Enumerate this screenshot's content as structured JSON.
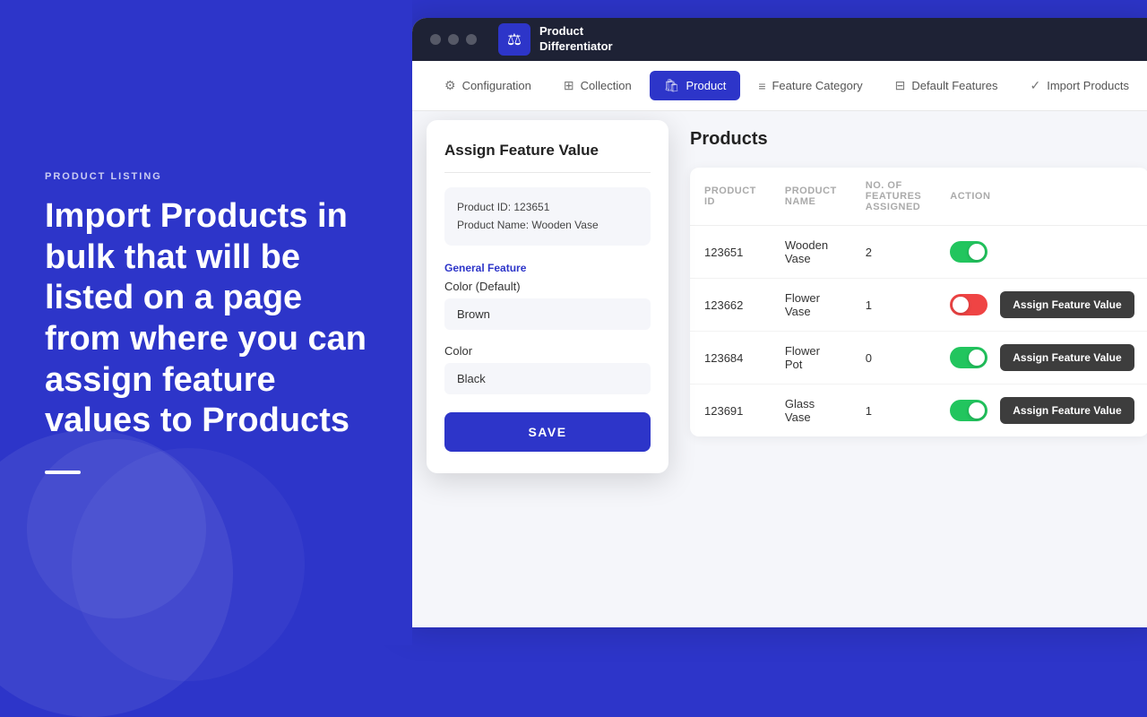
{
  "left": {
    "section_label": "PRODUCT LISTING",
    "heading": "Import Products in bulk that will be listed on a page from where you can assign feature values to Products"
  },
  "nav": {
    "tabs": [
      {
        "id": "configuration",
        "label": "Configuration",
        "icon": "⚙"
      },
      {
        "id": "collection",
        "label": "Collection",
        "icon": "⊞"
      },
      {
        "id": "product",
        "label": "Product",
        "icon": "🛍",
        "active": true
      },
      {
        "id": "feature-category",
        "label": "Feature Category",
        "icon": "≡"
      },
      {
        "id": "default-features",
        "label": "Default Features",
        "icon": "⊟"
      },
      {
        "id": "import-products",
        "label": "Import Products",
        "icon": "✓"
      }
    ]
  },
  "logo": {
    "text_line1": "Product",
    "text_line2": "Differentiator"
  },
  "modal": {
    "title": "Assign Feature Value",
    "product_id_label": "Product ID: 123651",
    "product_name_label": "Product Name: Wooden Vase",
    "section": "General Feature",
    "color_default_label": "Color (Default)",
    "color_default_value": "Brown",
    "color_label": "Color",
    "color_value": "Black",
    "save_label": "SAVE"
  },
  "products": {
    "title": "Products",
    "columns": [
      "Product ID",
      "Product Name",
      "No. of Features Assigned",
      "Action"
    ],
    "rows": [
      {
        "id": "123651",
        "name": "Wooden Vase",
        "features": "2",
        "toggle": "on",
        "btn": null
      },
      {
        "id": "123662",
        "name": "Flower Vase",
        "features": "1",
        "toggle": "off",
        "btn": "Assign Feature Value"
      },
      {
        "id": "123684",
        "name": "Flower Pot",
        "features": "0",
        "toggle": "on",
        "btn": "Assign Feature Value"
      },
      {
        "id": "123691",
        "name": "Glass Vase",
        "features": "1",
        "toggle": "on",
        "btn": "Assign Feature Value"
      }
    ]
  }
}
